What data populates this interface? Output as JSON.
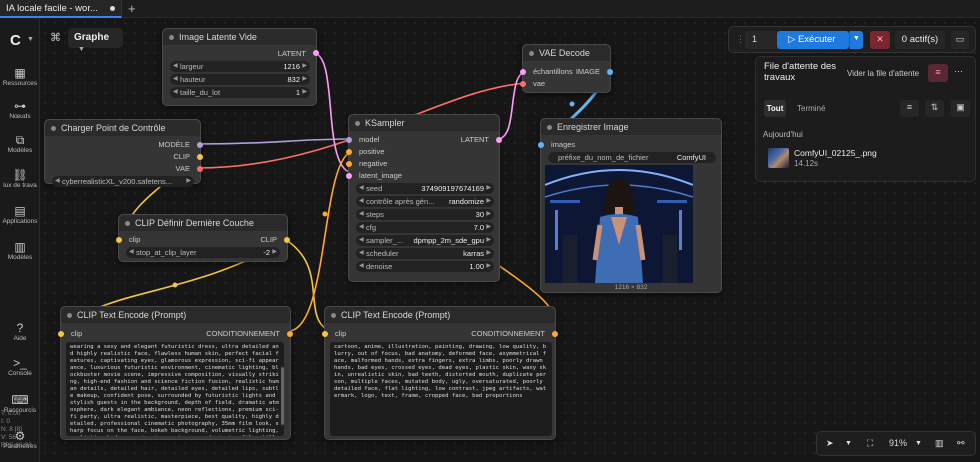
{
  "tab": {
    "title": "IA locale facile - wor..."
  },
  "sidebar": {
    "items": [
      {
        "label": "Ressources"
      },
      {
        "label": "Nœuds"
      },
      {
        "label": "Modèles"
      },
      {
        "label": "lux de trava"
      },
      {
        "label": "Applications"
      },
      {
        "label": "Modèles"
      },
      {
        "label": "Aide"
      },
      {
        "label": "Console"
      },
      {
        "label": "Raccourcis"
      },
      {
        "label": "Paramètres"
      }
    ],
    "stats": [
      "T: 0.00",
      "I: 0",
      "N: 8 [8]",
      "V: 56",
      "FPS:68.03"
    ]
  },
  "toolbar": {
    "graph_label": "Graphe",
    "queue_count": "1",
    "run_label": "Exécuter",
    "active_label": "0 actif(s)"
  },
  "queue": {
    "title": "File d'attente des travaux",
    "clear_label": "Vider la file d'attente",
    "tab_all": "Tout",
    "tab_done": "Terminé",
    "today": "Aujourd'hui",
    "item_file": "ComfyUI_02125_.png",
    "item_time": "14.12s"
  },
  "nodes": {
    "latent": {
      "title": "Image Latente Vide",
      "output": "LATENT",
      "widgets": [
        {
          "label": "largeur",
          "value": "1216"
        },
        {
          "label": "hauteur",
          "value": "832"
        },
        {
          "label": "taille_du_lot",
          "value": "1"
        }
      ]
    },
    "checkpoint": {
      "title": "Charger Point de Contrôle",
      "outputs": [
        "MODÈLE",
        "CLIP",
        "VAE"
      ],
      "widget_value": "cyberrealisticXL_v200.safetens..."
    },
    "clipskip": {
      "title": "CLIP Définir Dernière Couche",
      "input": "clip",
      "output": "CLIP",
      "widget_label": "stop_at_clip_layer",
      "widget_value": "-2"
    },
    "ksampler": {
      "title": "KSampler",
      "inputs": [
        "model",
        "positive",
        "negative",
        "latent_image"
      ],
      "output": "LATENT",
      "widgets": [
        {
          "label": "seed",
          "value": "374909197674169"
        },
        {
          "label": "contrôle après gén...",
          "value": "randomize"
        },
        {
          "label": "steps",
          "value": "30"
        },
        {
          "label": "cfg",
          "value": "7.0"
        },
        {
          "label": "sampler_...",
          "value": "dpmpp_2m_sde_gpu"
        },
        {
          "label": "scheduler",
          "value": "karras"
        },
        {
          "label": "denoise",
          "value": "1.00"
        }
      ]
    },
    "vae": {
      "title": "VAE Decode",
      "inputs": [
        "échantillons",
        "vae"
      ],
      "output": "IMAGE"
    },
    "save": {
      "title": "Enregistrer Image",
      "input": "images",
      "widget_label": "préfixe_du_nom_de_fichier",
      "widget_value": "ComfyUI",
      "image_size": "1216 × 832"
    },
    "pos": {
      "title": "CLIP Text Encode (Prompt)",
      "input": "clip",
      "output": "CONDITIONNEMENT",
      "text": "wearing a sexy and elegant futuristic dress, ultra detailed and highly realistic face, flawless human skin, perfect facial features, captivating eyes, glamorous expression, sci-fi appearance, luxurious futuristic environment, cinematic lighting, blockbuster movie scene, impressive composition, visually striking, high-end fashion and science fiction fusion, realistic human details, detailed hair, detailed eyes, detailed lips, subtle makeup, confident pose, surrounded by futuristic lights and stylish guests in the background, depth of field, dramatic atmosphere, dark elegant ambiance, neon reflections, premium sci-fi party, ultra realistic, masterpiece, best quality, highly detailed, professional cinematic photography, 35mm film look, sharp focus on the face, bokeh background, volumetric lighting, realistic shadows, epic, impressive, award-winning film still"
    },
    "neg": {
      "title": "CLIP Text Encode (Prompt)",
      "input": "clip",
      "output": "CONDITIONNEMENT",
      "text": "cartoon, anime, illustration, painting, drawing, low quality, blurry, out of focus, bad anatomy, deformed face, asymmetrical face, malformed hands, extra fingers, extra limbs, poorly drawn hands, bad eyes, crossed eyes, dead eyes, plastic skin, waxy skin, unrealistic skin, bad teeth, distorted mouth, duplicate person, multiple faces, mutated body, ugly, oversaturated, poorly detailed face, flat lighting, low contrast, jpeg artifacts, watermark, logo, text, frame, cropped face, bad proportions"
    }
  },
  "zoom": {
    "value": "91%"
  },
  "colors": {
    "model": "#b39ddb",
    "clip": "#f5c542",
    "vae": "#ff6e6e",
    "latent": "#ff9cf9",
    "image": "#64b5f6",
    "conditioning": "#ffa931",
    "run": "#1f7ae0"
  }
}
